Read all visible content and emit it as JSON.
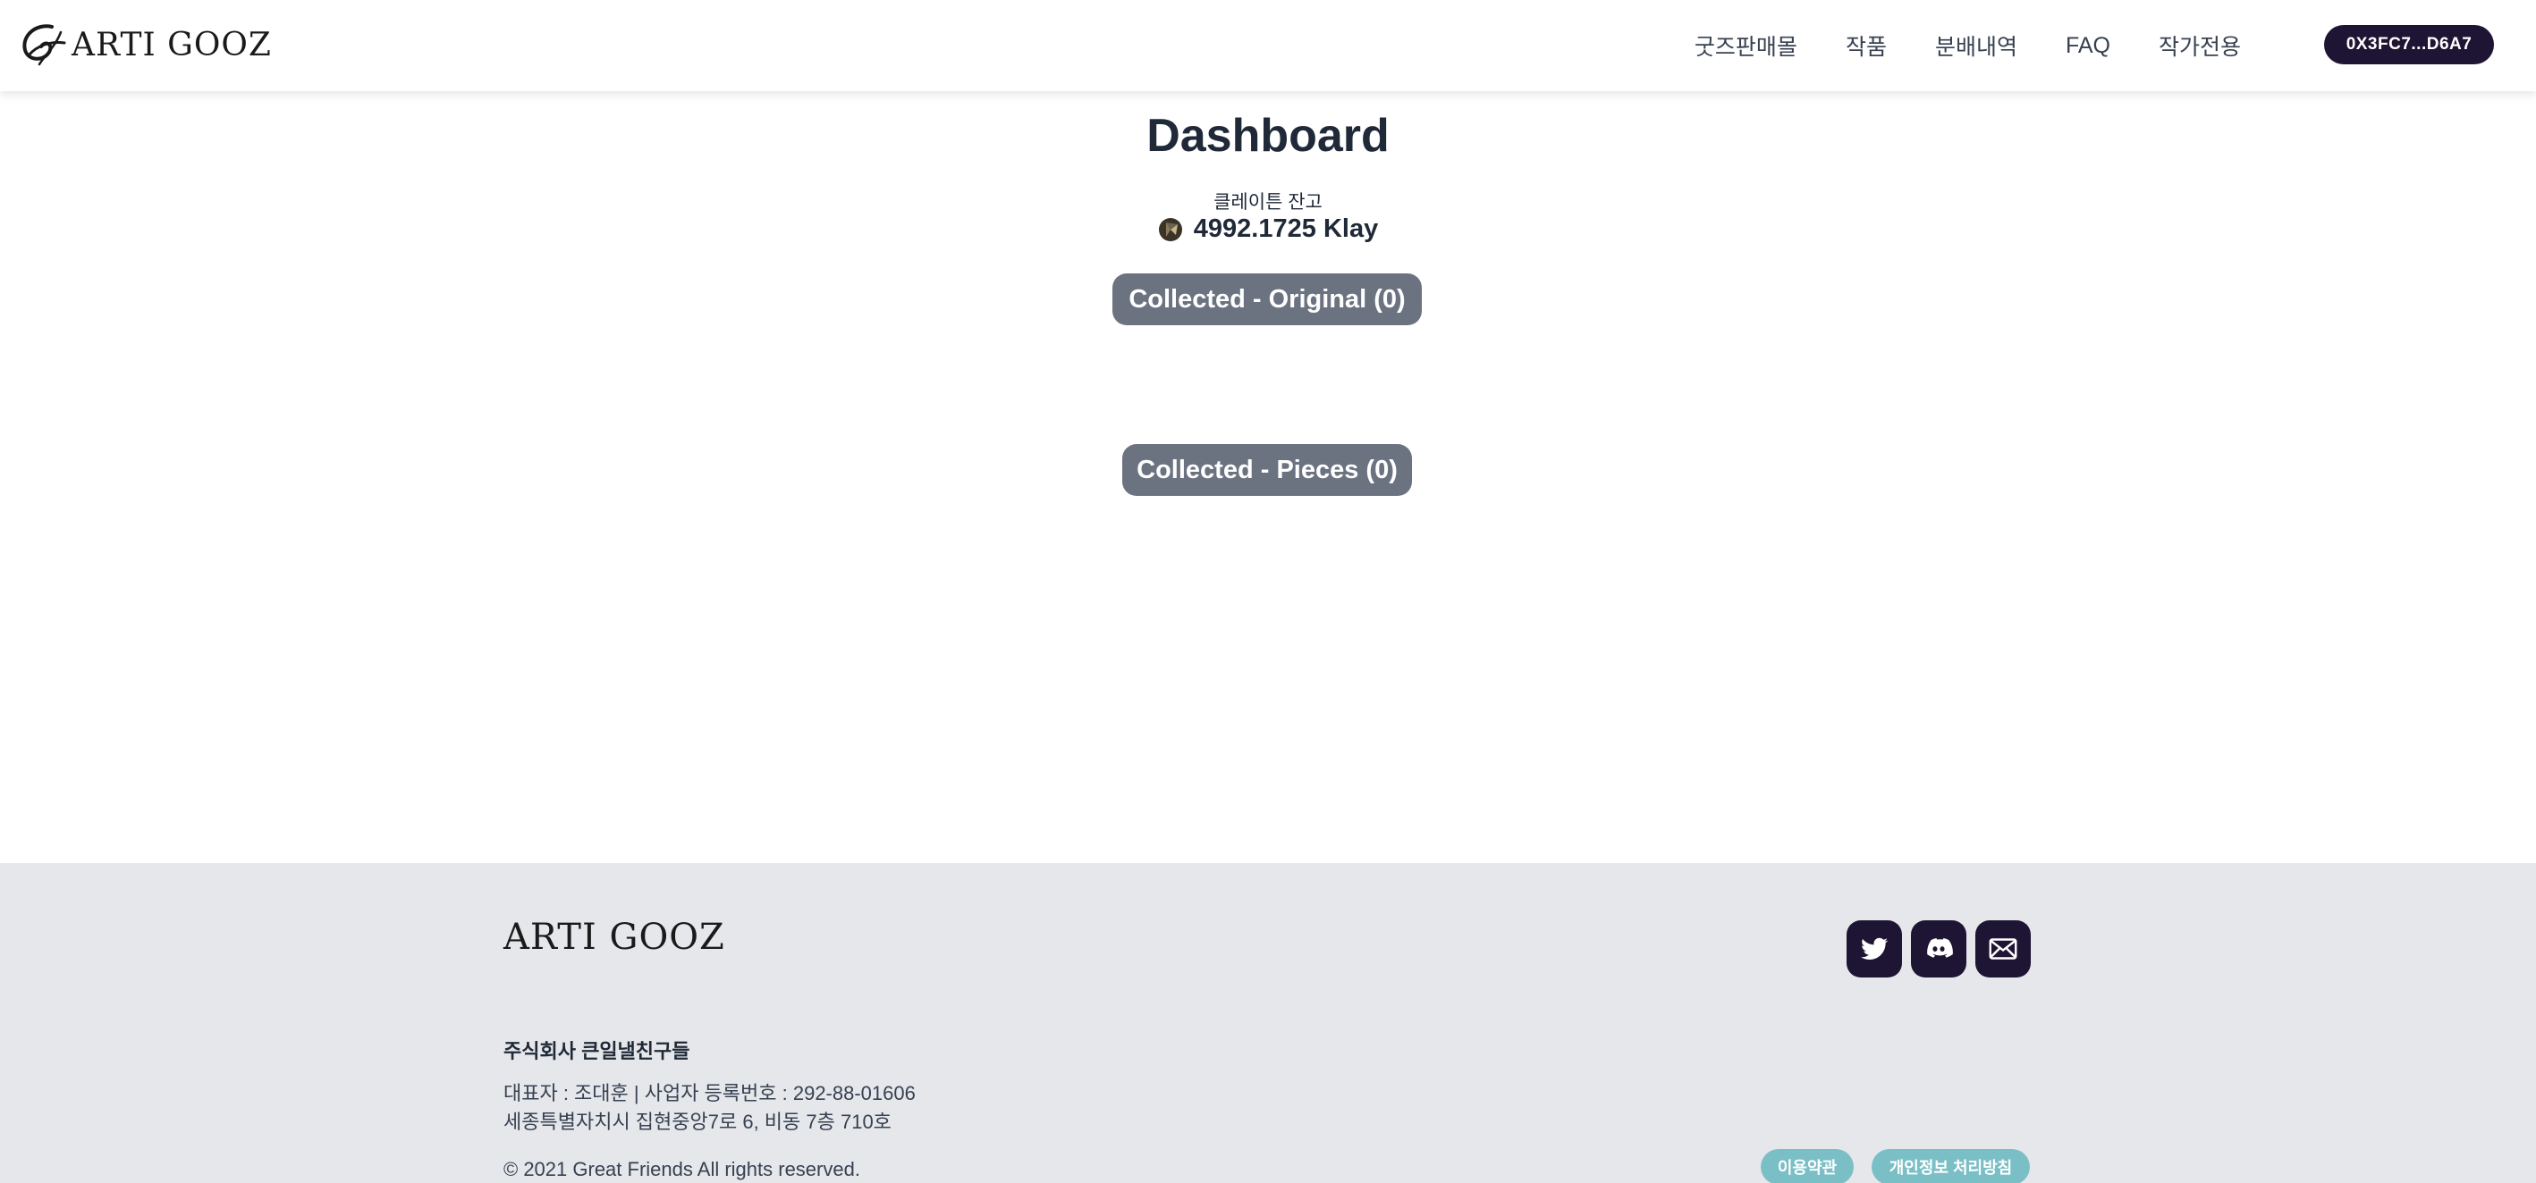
{
  "header": {
    "logo_text": "ARTI GOOZ",
    "nav": [
      {
        "label": "굿즈판매몰"
      },
      {
        "label": "작품"
      },
      {
        "label": "분배내역"
      },
      {
        "label": "FAQ"
      },
      {
        "label": "작가전용"
      }
    ],
    "wallet_label": "0X3FC7...D6A7"
  },
  "main": {
    "title": "Dashboard",
    "balance_label": "클레이튼 잔고",
    "balance_icon": "klay-coin-icon",
    "balance_value": "4992.1725 Klay",
    "collected_original": "Collected - Original (0)",
    "collected_pieces": "Collected - Pieces (0)"
  },
  "footer": {
    "logo_text": "ARTI GOOZ",
    "socials": [
      "twitter-icon",
      "discord-icon",
      "mail-icon"
    ],
    "company": "주식회사 큰일낼친구들",
    "info_line_1": "대표자 : 조대훈 | 사업자 등록번호 : 292-88-01606",
    "info_line_2": "세종특별자치시 집현중앙7로 6, 비동 7층 710호",
    "copyright": "© 2021 Great Friends All rights reserved.",
    "terms_label": "이용약관",
    "privacy_label": "개인정보 처리방침"
  },
  "colors": {
    "brand_dark": "#1e1433",
    "pill_gray": "#6b7280",
    "footer_bg": "#e5e7eb",
    "legal_teal": "#7bbfc6"
  }
}
